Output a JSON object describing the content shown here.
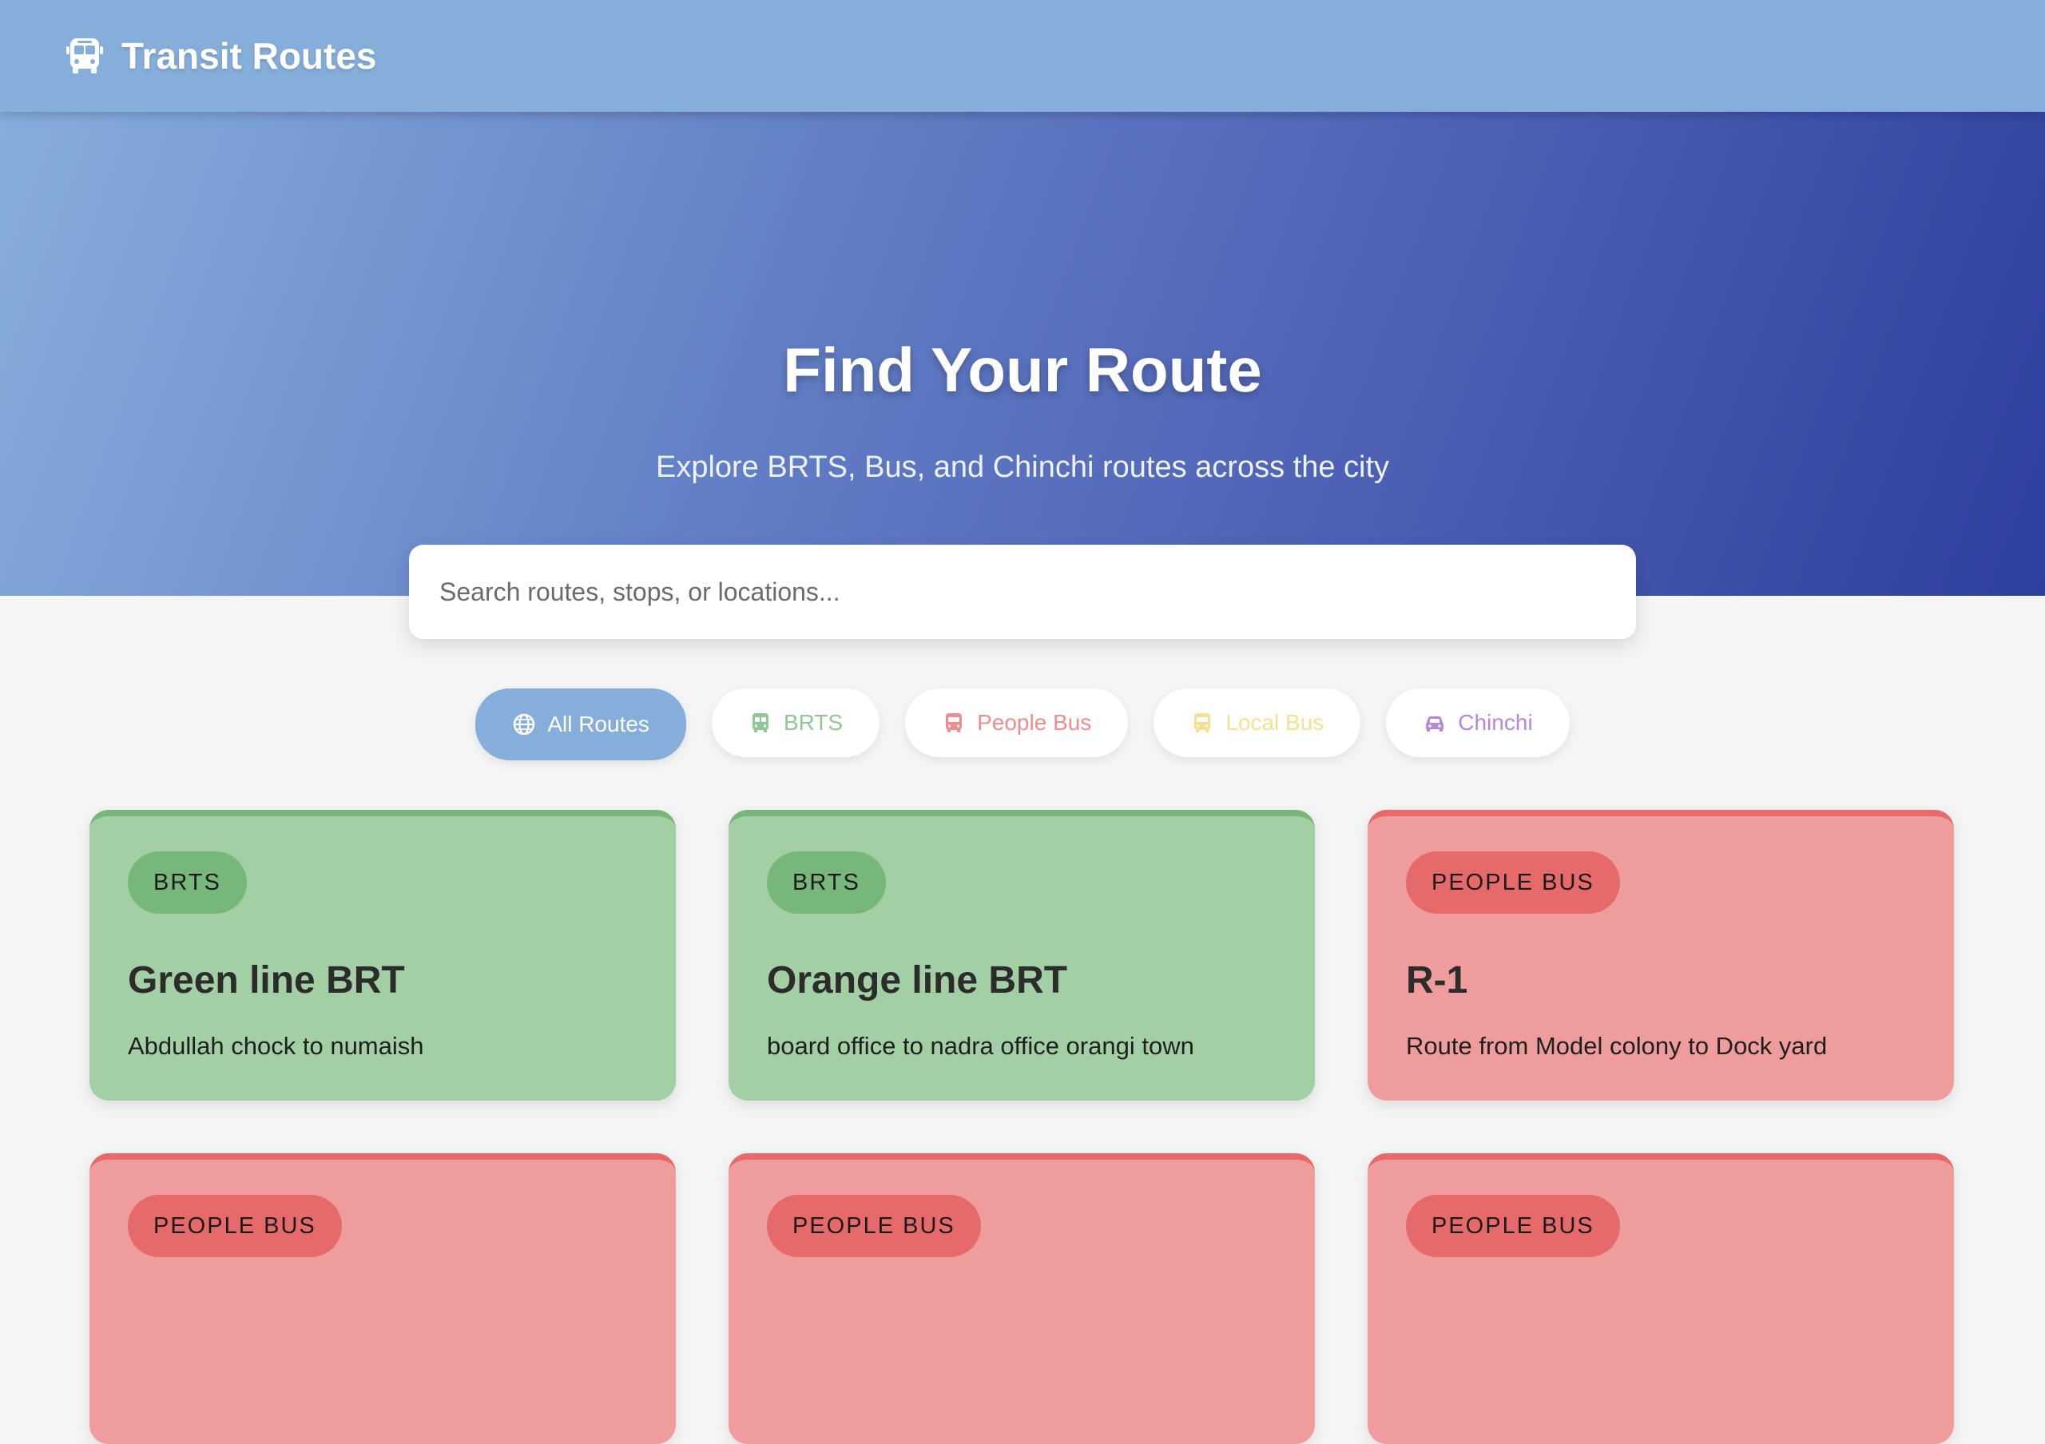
{
  "header": {
    "brand_icon": "bus-icon",
    "title": "Transit Routes"
  },
  "hero": {
    "title": "Find Your Route",
    "subtitle": "Explore BRTS, Bus, and Chinchi routes across the city"
  },
  "search": {
    "placeholder": "Search routes, stops, or locations...",
    "value": ""
  },
  "filters": [
    {
      "label": "All Routes",
      "icon": "globe-icon",
      "active": true,
      "color": "#ffffff"
    },
    {
      "label": "BRTS",
      "icon": "bus-icon",
      "active": false,
      "color": "#8fc795"
    },
    {
      "label": "People Bus",
      "icon": "bus-icon",
      "active": false,
      "color": "#ef8c8c"
    },
    {
      "label": "Local Bus",
      "icon": "bus-icon",
      "active": false,
      "color": "#f7e08f"
    },
    {
      "label": "Chinchi",
      "icon": "car-icon",
      "active": false,
      "color": "#b887d6"
    }
  ],
  "colors": {
    "brts_card": "#a2cfa3",
    "brts_accent": "#77b87a",
    "people_card": "#ef9c9c",
    "people_accent": "#e66a6a",
    "navbar": "#86aedb"
  },
  "routes": [
    {
      "type": "BRTS",
      "title": "Green line BRT",
      "description": "Abdullah chock to numaish"
    },
    {
      "type": "BRTS",
      "title": "Orange line BRT",
      "description": "board office to nadra office orangi town"
    },
    {
      "type": "PEOPLE BUS",
      "title": "R-1",
      "description": "Route from Model colony to Dock yard"
    },
    {
      "type": "PEOPLE BUS",
      "title": "",
      "description": ""
    },
    {
      "type": "PEOPLE BUS",
      "title": "",
      "description": ""
    },
    {
      "type": "PEOPLE BUS",
      "title": "",
      "description": ""
    }
  ]
}
